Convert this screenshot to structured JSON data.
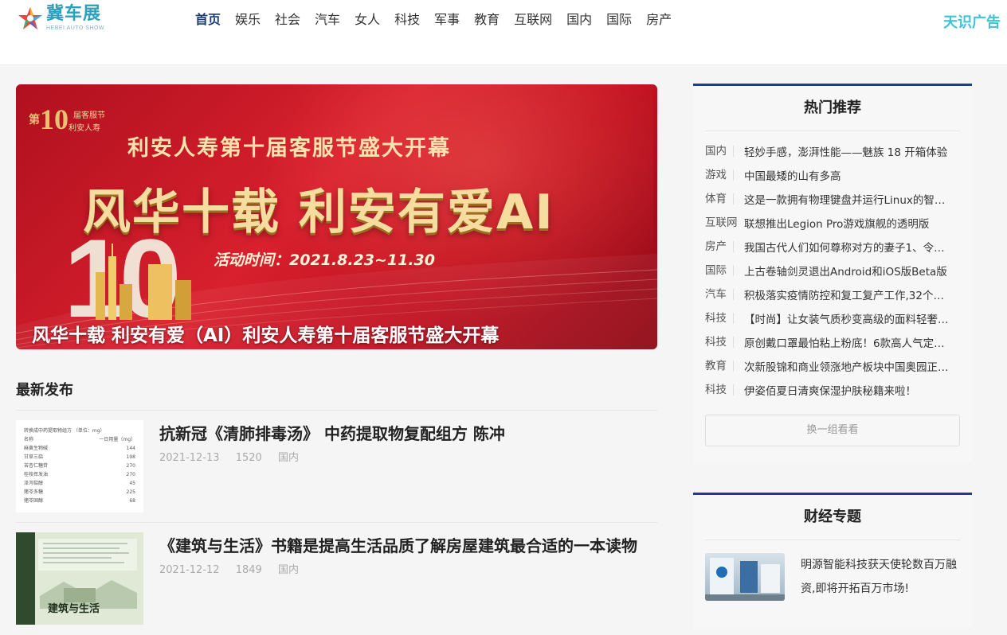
{
  "header": {
    "logo_cn": "冀车展",
    "logo_en": "HEBEI AUTO SHOW",
    "nav": [
      "首页",
      "娱乐",
      "社会",
      "汽车",
      "女人",
      "科技",
      "军事",
      "教育",
      "互联网",
      "国内",
      "国际",
      "房产"
    ],
    "active_nav": "首页",
    "ad_label": "天识广告"
  },
  "banner": {
    "badge_number": "10",
    "badge_prefix": "第",
    "badge_line1": "届客服节",
    "badge_line2": "利安人寿",
    "headline": "利安人寿第十届客服节盛大开幕",
    "slogan": "风华十载  利安有爱AI",
    "time": "活动时间：2021.8.23~11.30",
    "big_number": "10",
    "caption": "风华十载 利安有爱（AI）利安人寿第十届客服节盛大开幕"
  },
  "latest": {
    "title": "最新发布",
    "posts": [
      {
        "title": "抗新冠《清肺排毒汤》 中药提取物复配组方 陈冲",
        "date": "2021-12-13",
        "views": "1520",
        "category": "国内",
        "thumb_rows": [
          [
            "转换成中药提取物组方 （单位：mg）",
            ""
          ],
          [
            "名称",
            "一日用量（mg）"
          ],
          [
            "麻黄生物碱",
            "144"
          ],
          [
            "甘草三萜",
            "198"
          ],
          [
            "苦杏仁糖苷",
            "270"
          ],
          [
            "桂枝挥发油",
            "270"
          ],
          [
            "泽泻萜醇",
            "45"
          ],
          [
            "猪苓多糖",
            "225"
          ],
          [
            "猪苓固醇",
            "68"
          ]
        ]
      },
      {
        "title": "《建筑与生活》书籍是提高生活品质了解房屋建筑最合适的一本读物",
        "date": "2021-12-12",
        "views": "1849",
        "category": "国内",
        "thumb_cover_title": "建筑与生活"
      }
    ]
  },
  "hot": {
    "title": "热门推荐",
    "items": [
      {
        "cat": "国内",
        "text": "轻妙手感，澎湃性能——魅族 18 开箱体验"
      },
      {
        "cat": "游戏",
        "text": "中国最矮的山有多高"
      },
      {
        "cat": "体育",
        "text": "这是一款拥有物理键盘并运行Linux的智…"
      },
      {
        "cat": "互联网",
        "text": "联想推出Legion Pro游戏旗舰的透明版"
      },
      {
        "cat": "房产",
        "text": "我国古代人们如何尊称对方的妻子1、令…"
      },
      {
        "cat": "国际",
        "text": "上古卷轴剑灵退出Android和iOS版Beta版"
      },
      {
        "cat": "汽车",
        "text": "积极落实疫情防控和复工复产工作,32个…"
      },
      {
        "cat": "科技",
        "text": "【时尚】让女装气质秒变高级的面料轻奢…"
      },
      {
        "cat": "科技",
        "text": "原创戴口罩最怕粘上粉底！6款高人气定…"
      },
      {
        "cat": "教育",
        "text": "次新股锦和商业领涨地产板块中国奥园正…"
      },
      {
        "cat": "科技",
        "text": "伊姿佰夏日清爽保湿护肤秘籍来啦！"
      }
    ],
    "refresh_label": "换一组看看"
  },
  "finance": {
    "title": "财经专题",
    "items": [
      {
        "text": "明源智能科技获天使轮数百万融资,即将开拓百万市场!"
      }
    ]
  }
}
